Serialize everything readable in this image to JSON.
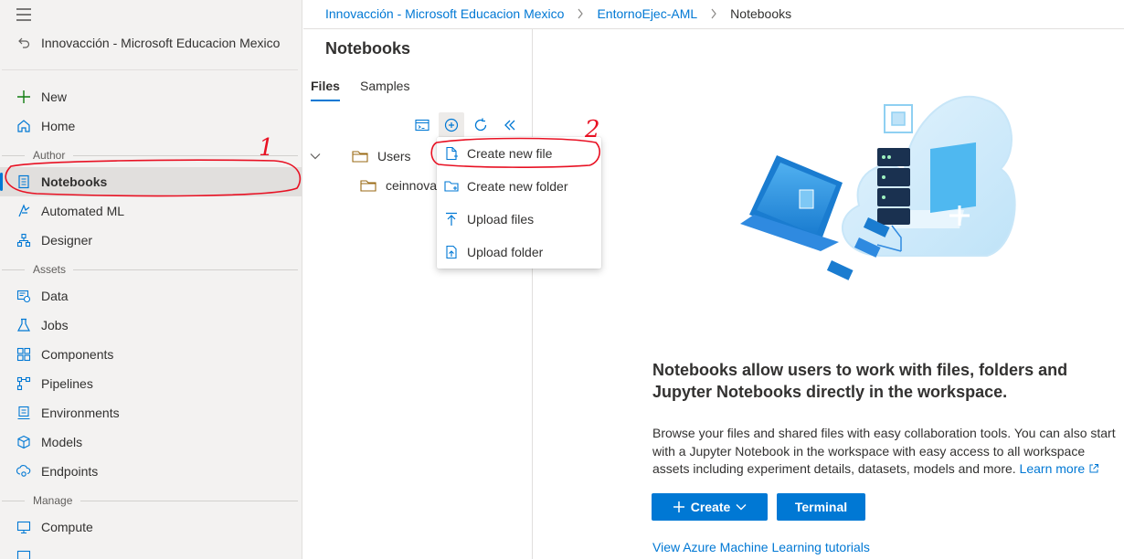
{
  "nav": {
    "back_label": "Innovacción - Microsoft Educacion Mexico",
    "top_items": [
      {
        "label": "New",
        "icon": "plus-icon"
      },
      {
        "label": "Home",
        "icon": "home-icon"
      }
    ],
    "sections": {
      "author": "Author",
      "assets": "Assets",
      "manage": "Manage"
    },
    "author_items": [
      {
        "label": "Notebooks",
        "icon": "notebook-icon",
        "active": true
      },
      {
        "label": "Automated ML",
        "icon": "automl-icon"
      },
      {
        "label": "Designer",
        "icon": "designer-icon"
      }
    ],
    "asset_items": [
      {
        "label": "Data",
        "icon": "data-icon"
      },
      {
        "label": "Jobs",
        "icon": "flask-icon"
      },
      {
        "label": "Components",
        "icon": "components-icon"
      },
      {
        "label": "Pipelines",
        "icon": "pipelines-icon"
      },
      {
        "label": "Environments",
        "icon": "environments-icon"
      },
      {
        "label": "Models",
        "icon": "cube-icon"
      },
      {
        "label": "Endpoints",
        "icon": "endpoints-icon"
      }
    ],
    "manage_items": [
      {
        "label": "Compute",
        "icon": "compute-icon"
      }
    ]
  },
  "breadcrumb": {
    "items": [
      "Innovacción - Microsoft Educacion Mexico",
      "EntornoEjec-AML"
    ],
    "current": "Notebooks"
  },
  "files_pane": {
    "title": "Notebooks",
    "tabs": [
      "Files",
      "Samples"
    ],
    "active_tab": "Files",
    "tree": {
      "root": "Users",
      "child": "ceinnova"
    }
  },
  "create_menu": {
    "items": [
      {
        "label": "Create new file",
        "icon": "new-file-icon"
      },
      {
        "label": "Create new folder",
        "icon": "new-folder-icon"
      },
      {
        "label": "Upload files",
        "icon": "upload-icon"
      },
      {
        "label": "Upload folder",
        "icon": "upload-folder-icon"
      }
    ]
  },
  "main": {
    "headline": "Notebooks allow users to work with files, folders and Jupyter Notebooks directly in the workspace.",
    "description": "Browse your files and shared files with easy collaboration tools. You can also start with a Jupyter Notebook in the workspace with easy access to all workspace assets including experiment details, datasets, models and more.",
    "learn_more": "Learn more",
    "create_label": "Create",
    "terminal_label": "Terminal",
    "tutorial_link": "View Azure Machine Learning tutorials"
  },
  "annotations": {
    "mark_1": "1",
    "mark_2": "2"
  },
  "colors": {
    "accent": "#0078d4",
    "annotation": "#e81123"
  }
}
